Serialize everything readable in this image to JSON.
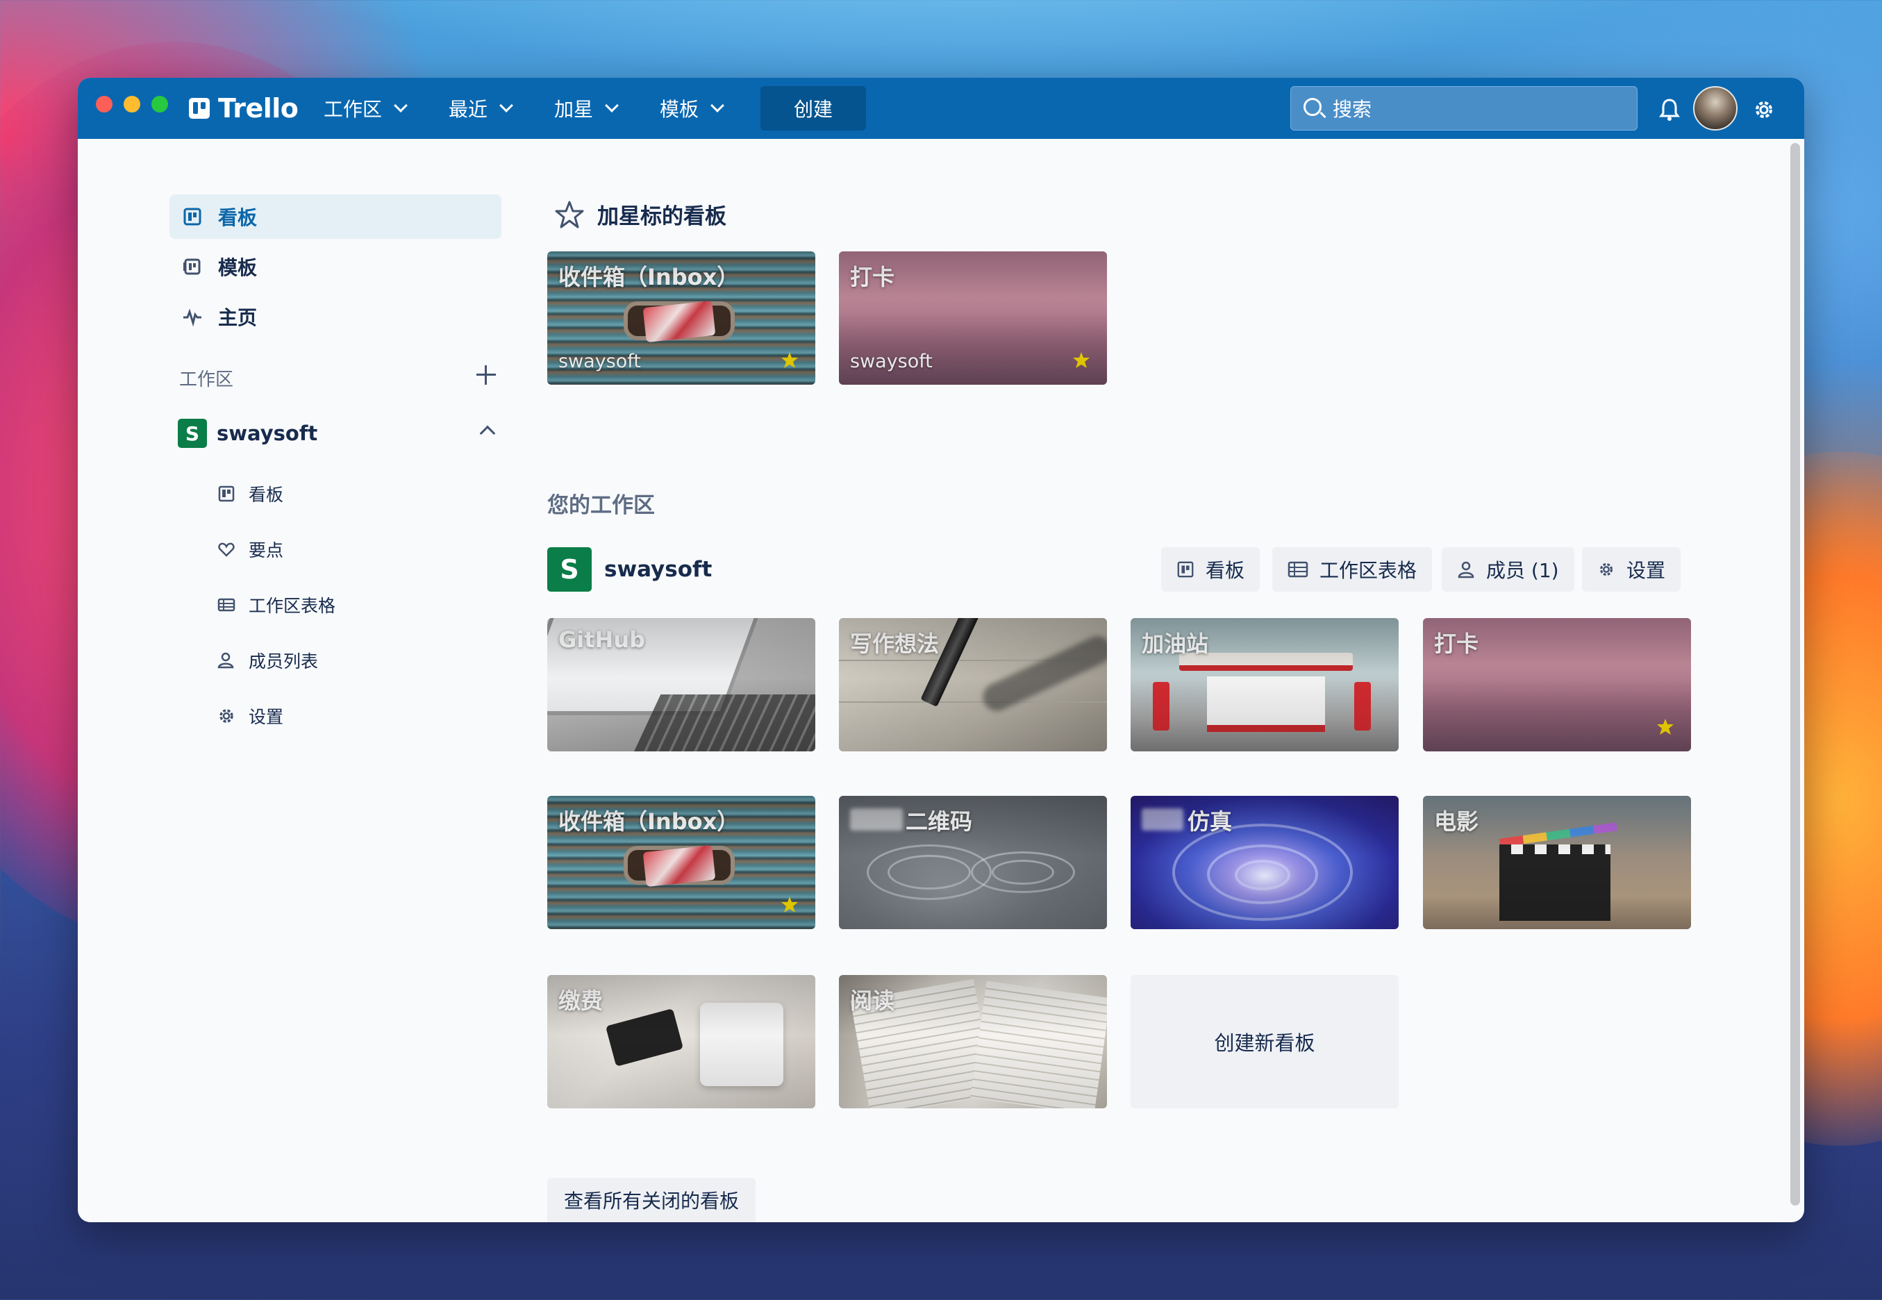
{
  "app": {
    "logo_text": "Trello"
  },
  "topnav": {
    "items": [
      {
        "label": "工作区"
      },
      {
        "label": "最近"
      },
      {
        "label": "加星"
      },
      {
        "label": "模板"
      }
    ],
    "create_label": "创建",
    "search_placeholder": "搜索"
  },
  "sidebar": {
    "items": [
      {
        "label": "看板",
        "icon": "board-icon",
        "active": true
      },
      {
        "label": "模板",
        "icon": "template-icon"
      },
      {
        "label": "主页",
        "icon": "activity-icon"
      }
    ],
    "workspace_heading": "工作区",
    "workspace": {
      "badge": "S",
      "name": "swaysoft"
    },
    "workspace_items": [
      {
        "label": "看板",
        "icon": "board-icon"
      },
      {
        "label": "要点",
        "icon": "heart-icon"
      },
      {
        "label": "工作区表格",
        "icon": "table-icon"
      },
      {
        "label": "成员列表",
        "icon": "members-icon"
      },
      {
        "label": "设置",
        "icon": "gear-icon"
      }
    ]
  },
  "starred": {
    "title": "加星标的看板",
    "boards": [
      {
        "title": "收件箱（Inbox）",
        "workspace": "swaysoft",
        "starred": true
      },
      {
        "title": "打卡",
        "workspace": "swaysoft",
        "starred": true
      }
    ]
  },
  "your_workspaces": {
    "title": "您的工作区",
    "workspace": {
      "badge": "S",
      "name": "swaysoft"
    },
    "tabs": [
      {
        "label": "看板",
        "icon": "board-icon"
      },
      {
        "label": "工作区表格",
        "icon": "table-icon"
      },
      {
        "label": "成员 (1)",
        "icon": "person-icon"
      },
      {
        "label": "设置",
        "icon": "gear-icon"
      }
    ],
    "boards": [
      {
        "title": "GitHub",
        "starred": false
      },
      {
        "title": "写作想法",
        "starred": false
      },
      {
        "title": "加油站",
        "starred": false
      },
      {
        "title": "打卡",
        "starred": true
      },
      {
        "title": "收件箱（Inbox）",
        "starred": true
      },
      {
        "title": "二维码",
        "starred": false
      },
      {
        "title": "仿真",
        "starred": false
      },
      {
        "title": "电影",
        "starred": false
      },
      {
        "title": "缴费",
        "starred": false
      },
      {
        "title": "阅读",
        "starred": false
      }
    ],
    "create_new_label": "创建新看板",
    "view_closed_label": "查看所有关闭的看板"
  },
  "colors": {
    "header": "#0967b0",
    "create_button": "#05548f",
    "workspace_badge": "#0b7d48",
    "active_sidebar_bg": "#e4f0f6",
    "star": "#f2d600"
  }
}
